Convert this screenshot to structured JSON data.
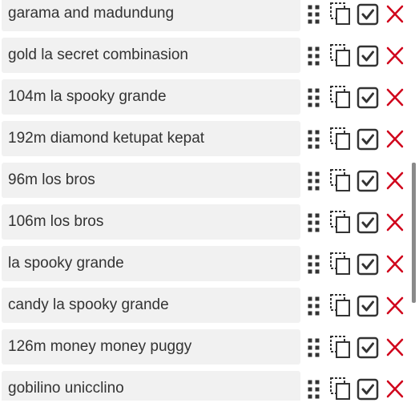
{
  "items": [
    {
      "label": "garama and madundung"
    },
    {
      "label": "gold la secret combinasion"
    },
    {
      "label": "104m la spooky grande"
    },
    {
      "label": "192m diamond ketupat kepat"
    },
    {
      "label": "96m los bros"
    },
    {
      "label": "106m los bros"
    },
    {
      "label": "la spooky grande"
    },
    {
      "label": "candy la spooky grande"
    },
    {
      "label": "126m money money puggy"
    },
    {
      "label": "gobilino unicclino"
    }
  ],
  "icons": {
    "drag": "drag-handle-icon",
    "duplicate": "duplicate-icon",
    "checkbox": "checkbox-checked-icon",
    "delete": "delete-icon"
  },
  "colors": {
    "field_bg": "#f1f1f1",
    "text": "#333333",
    "icon": "#333333",
    "delete": "#d0021b",
    "scrollbar": "#8a8a8a"
  }
}
